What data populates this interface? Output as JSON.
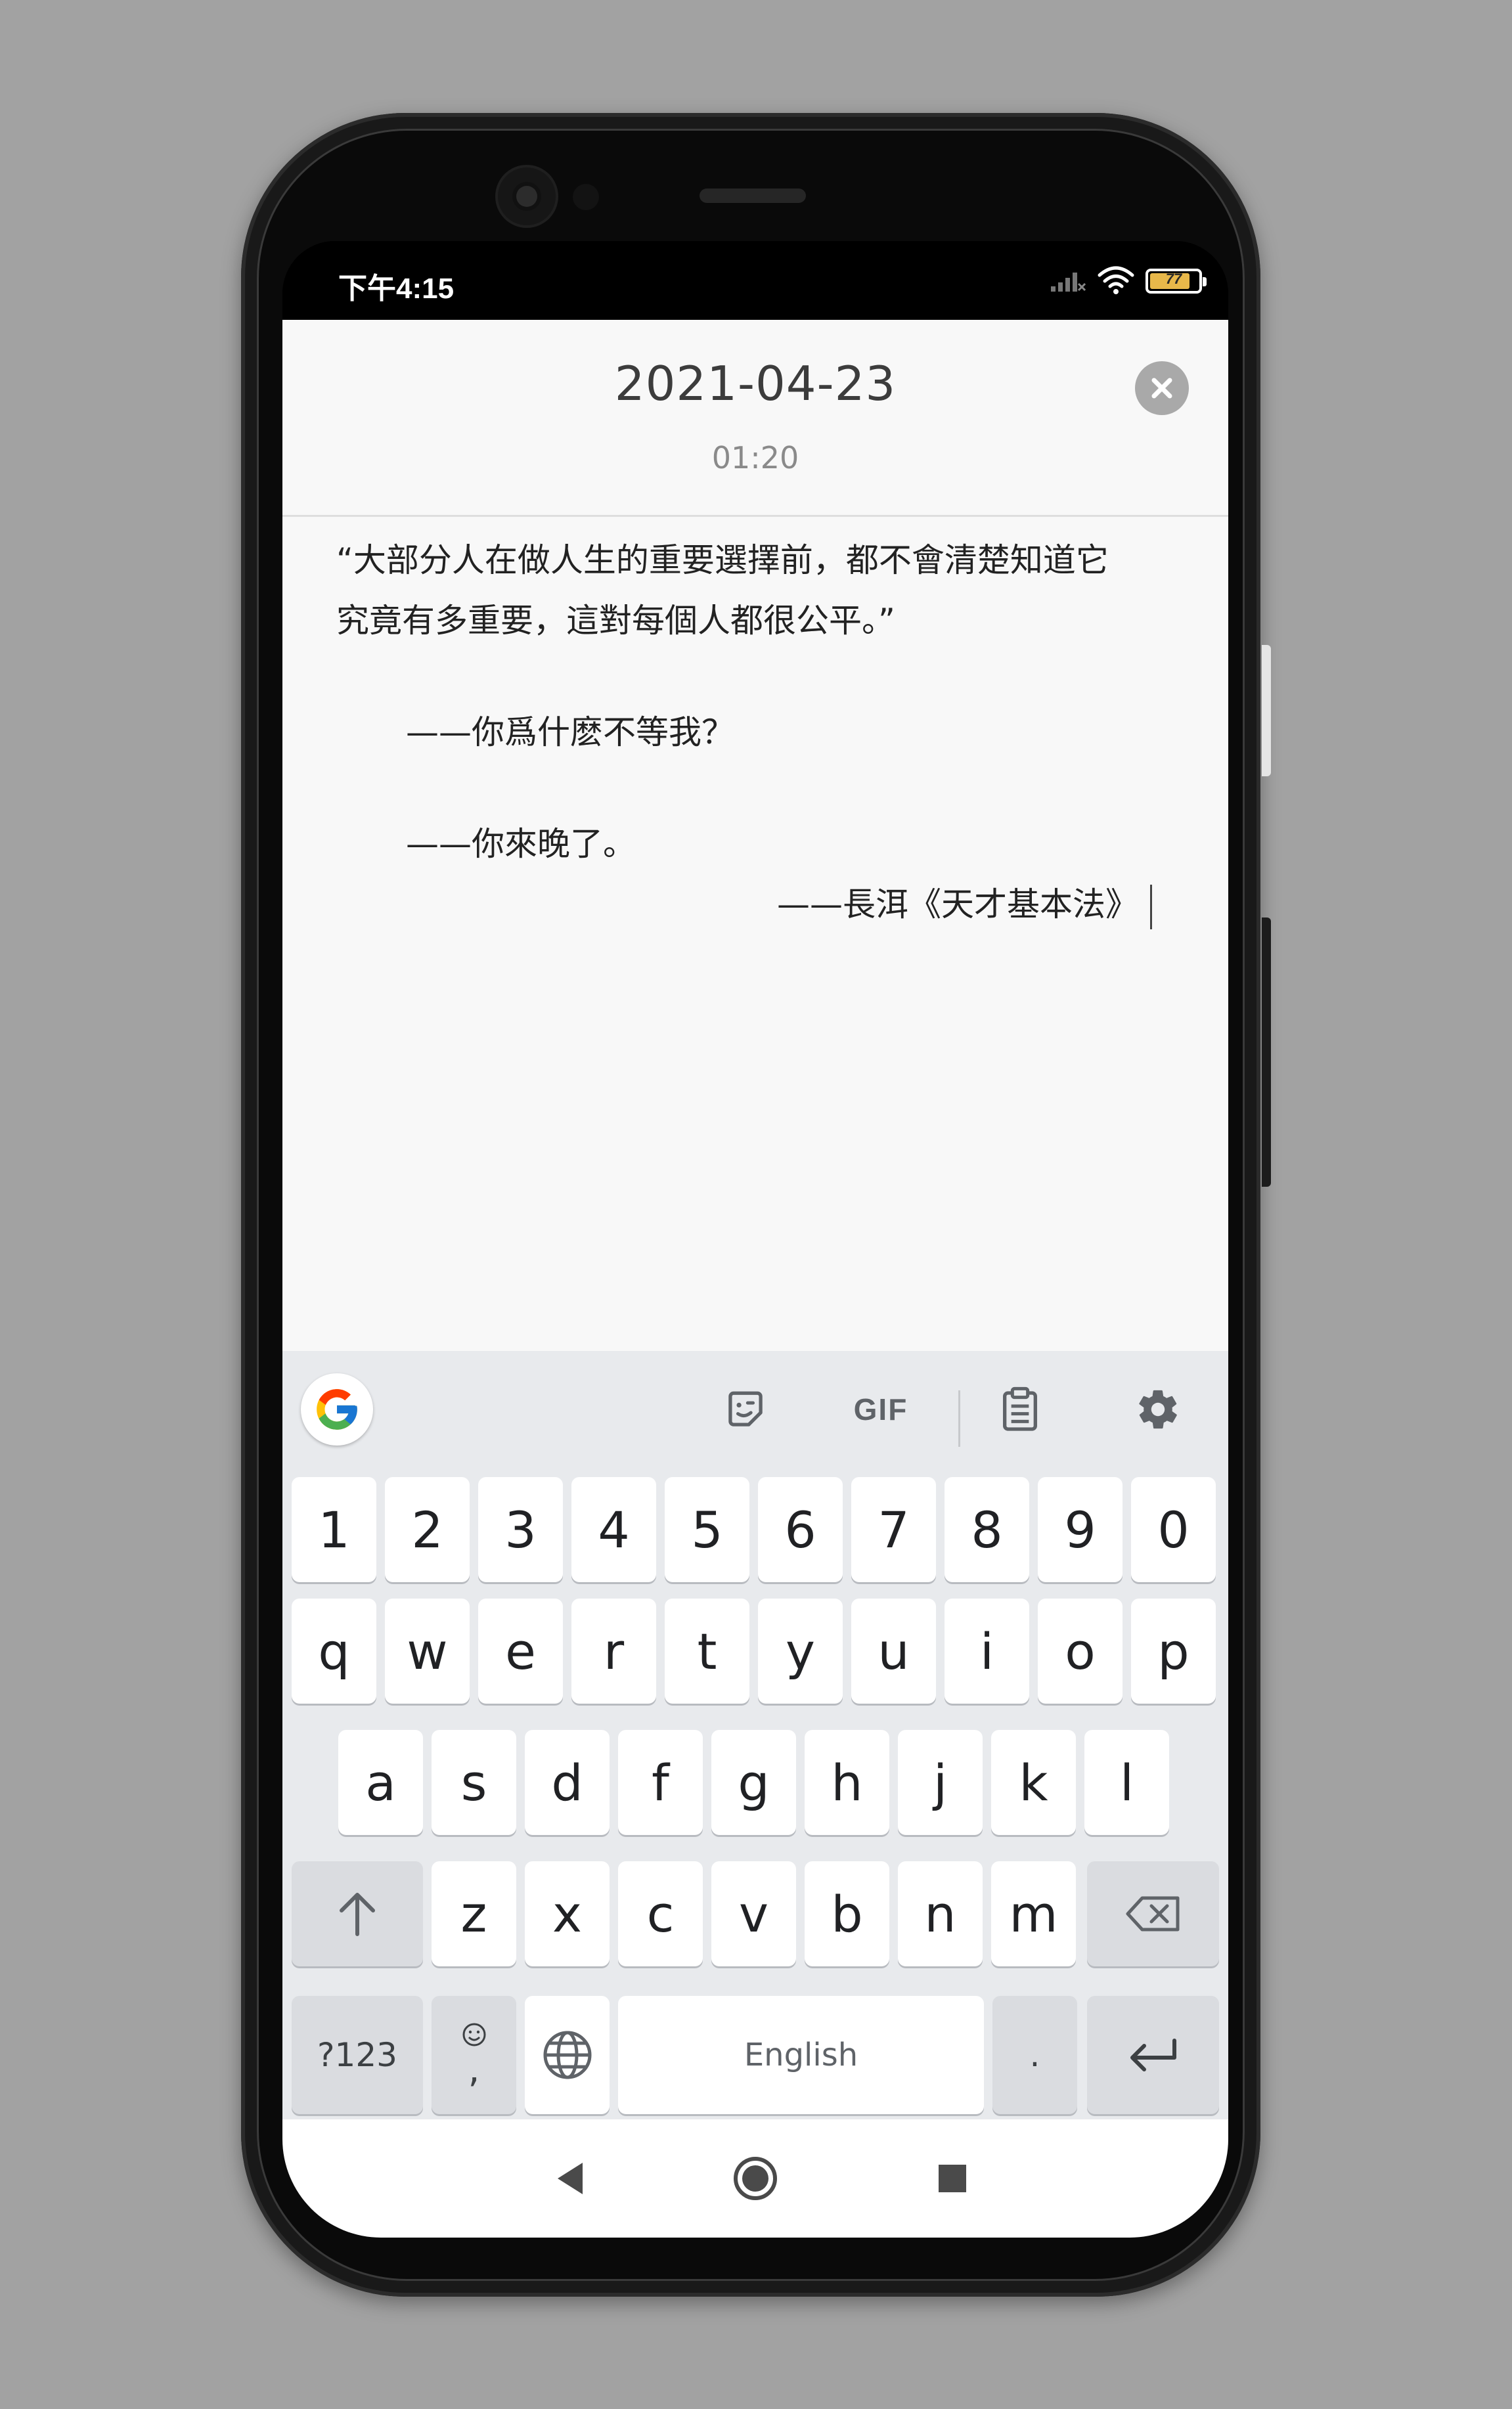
{
  "status_bar": {
    "time": "下午4:15",
    "battery_level": "77",
    "battery_color": "#e8b84a"
  },
  "note": {
    "date": "2021-04-23",
    "time": "01:20",
    "lines": [
      "“大部分人在做人生的重要選擇前，都不會清楚知道它",
      "究竟有多重要，這對每個人都很公平。”",
      "——你爲什麽不等我？",
      "——你來晚了。",
      "——長洱《天才基本法》"
    ]
  },
  "keyboard": {
    "toolbar": {
      "gif_label": "GIF",
      "icons": [
        "google-g-icon",
        "sticker-icon",
        "gif-icon",
        "clipboard-icon",
        "settings-gear-icon",
        "more-dots-icon"
      ]
    },
    "row_numbers": [
      "1",
      "2",
      "3",
      "4",
      "5",
      "6",
      "7",
      "8",
      "9",
      "0"
    ],
    "row_q": [
      "q",
      "w",
      "e",
      "r",
      "t",
      "y",
      "u",
      "i",
      "o",
      "p"
    ],
    "row_a": [
      "a",
      "s",
      "d",
      "f",
      "g",
      "h",
      "j",
      "k",
      "l"
    ],
    "row_z": [
      "z",
      "x",
      "c",
      "v",
      "b",
      "n",
      "m"
    ],
    "symbols_label": "?123",
    "emoji_comma_label": ",",
    "space_label": "English",
    "period_label": "."
  }
}
